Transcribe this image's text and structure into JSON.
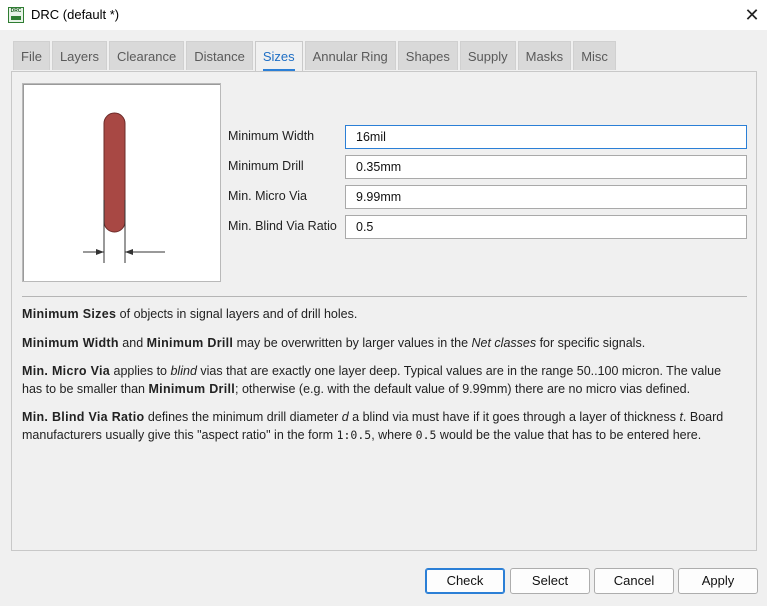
{
  "window": {
    "icon_text": "DRC",
    "title": "DRC (default *)",
    "close_glyph": "✕"
  },
  "tabs": [
    {
      "label": "File",
      "active": false
    },
    {
      "label": "Layers",
      "active": false
    },
    {
      "label": "Clearance",
      "active": false
    },
    {
      "label": "Distance",
      "active": false
    },
    {
      "label": "Sizes",
      "active": true
    },
    {
      "label": "Annular Ring",
      "active": false
    },
    {
      "label": "Shapes",
      "active": false
    },
    {
      "label": "Supply",
      "active": false
    },
    {
      "label": "Masks",
      "active": false
    },
    {
      "label": "Misc",
      "active": false
    }
  ],
  "preview": {
    "trace_color": "#a84844",
    "arrow_color": "#333333"
  },
  "fields": [
    {
      "label": "Minimum Width",
      "value": "16mil",
      "focused": true
    },
    {
      "label": "Minimum Drill",
      "value": "0.35mm",
      "focused": false
    },
    {
      "label": "Min. Micro Via",
      "value": "9.99mm",
      "focused": false
    },
    {
      "label": "Min. Blind Via Ratio",
      "value": "0.5",
      "focused": false
    }
  ],
  "help": {
    "p1": {
      "b1": "Minimum Sizes",
      "t1": " of objects in signal layers and of drill holes."
    },
    "p2": {
      "b1": "Minimum Width",
      "t1": " and ",
      "b2": "Minimum Drill",
      "t2": " may be overwritten by larger values in the ",
      "i1": "Net classes",
      "t3": " for specific signals."
    },
    "p3": {
      "b1": "Min. Micro Via",
      "t1": " applies to ",
      "i1": "blind",
      "t2": " vias that are exactly one layer deep. Typical values are in the range 50..100 micron. The value has to be smaller than ",
      "b2": "Minimum Drill",
      "t3": "; otherwise (e.g. with the default value of 9.99mm) there are no micro vias defined."
    },
    "p4": {
      "b1": "Min. Blind Via Ratio",
      "t1": " defines the minimum drill diameter ",
      "i1": "d",
      "t2": " a blind via must have if it goes through a layer of thickness ",
      "i2": "t",
      "t3": ". Board manufacturers usually give this \"aspect ratio\" in the form ",
      "c1": "1:0.5",
      "t4": ", where ",
      "c2": "0.5",
      "t5": " would be the value that has to be entered here."
    }
  },
  "buttons": {
    "check": "Check",
    "select": "Select",
    "cancel": "Cancel",
    "apply": "Apply"
  },
  "colors": {
    "accent": "#2b7fd6",
    "active_tab_text": "#1f6fc5"
  }
}
